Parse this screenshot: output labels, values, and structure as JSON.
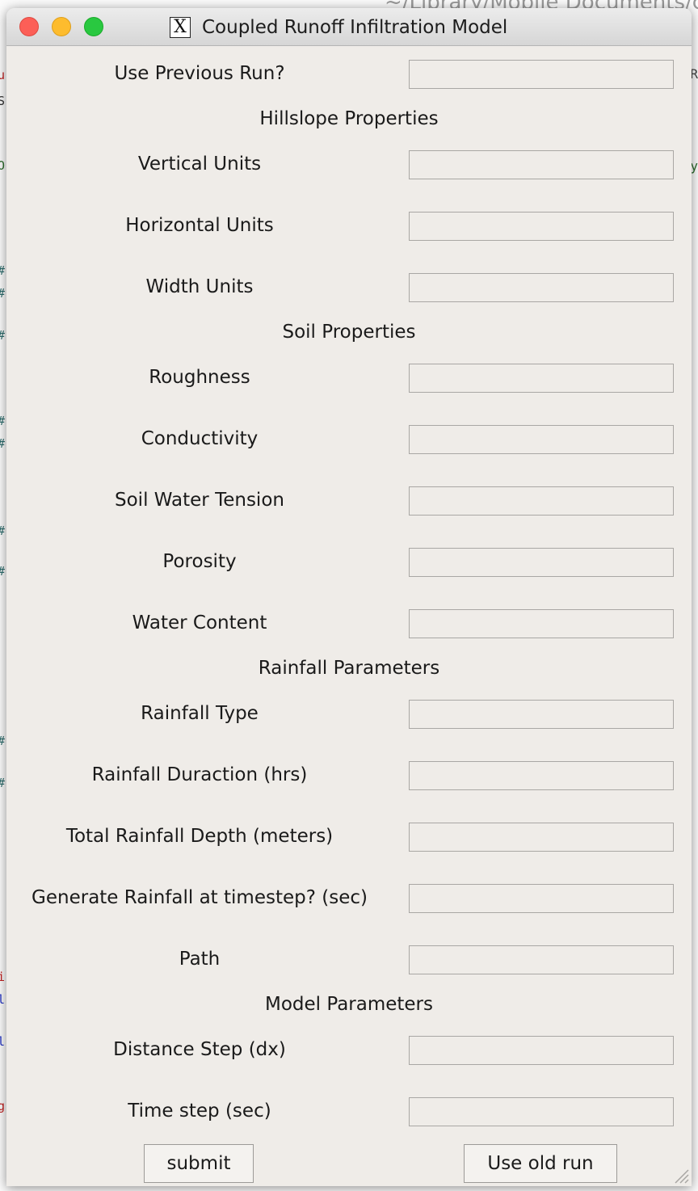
{
  "background": {
    "path_text": "~/Library/Mobile Documents/co"
  },
  "window": {
    "title": "Coupled Runoff Infiltration Model",
    "app_icon": "x11-icon"
  },
  "form": {
    "use_previous_run": "Use Previous Run?",
    "sections": {
      "hillslope": "Hillslope Properties",
      "soil": "Soil Properties",
      "rainfall": "Rainfall Parameters",
      "model": "Model Parameters"
    },
    "fields": {
      "vertical_units": "Vertical Units",
      "horizontal_units": "Horizontal Units",
      "width_units": "Width Units",
      "roughness": "Roughness",
      "conductivity": "Conductivity",
      "soil_water_tension": "Soil Water Tension",
      "porosity": "Porosity",
      "water_content": "Water Content",
      "rainfall_type": "Rainfall Type",
      "rainfall_duration": "Rainfall Duraction (hrs)",
      "total_rainfall_depth": "Total Rainfall Depth (meters)",
      "generate_rainfall": "Generate Rainfall at timestep? (sec)",
      "path": "Path",
      "distance_step": "Distance Step (dx)",
      "time_step": "Time step (sec)"
    },
    "values": {
      "use_previous_run": "",
      "vertical_units": "",
      "horizontal_units": "",
      "width_units": "",
      "roughness": "",
      "conductivity": "",
      "soil_water_tension": "",
      "porosity": "",
      "water_content": "",
      "rainfall_type": "",
      "rainfall_duration": "",
      "total_rainfall_depth": "",
      "generate_rainfall": "",
      "path": "",
      "distance_step": "",
      "time_step": ""
    }
  },
  "buttons": {
    "submit": "submit",
    "use_old_run": "Use old run"
  },
  "colors": {
    "window_bg": "#efece8",
    "close": "#fc5f57",
    "minimize": "#fdbc2e",
    "zoom": "#29c840"
  }
}
